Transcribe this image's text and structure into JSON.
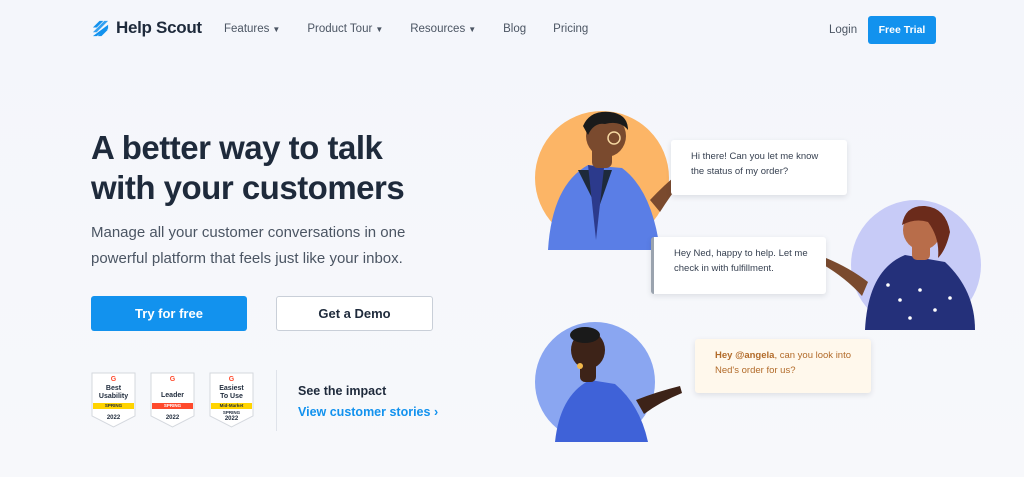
{
  "nav": {
    "brand": "Help Scout",
    "links": [
      {
        "label": "Features",
        "dropdown": true
      },
      {
        "label": "Product Tour",
        "dropdown": true
      },
      {
        "label": "Resources",
        "dropdown": true
      },
      {
        "label": "Blog",
        "dropdown": false
      },
      {
        "label": "Pricing",
        "dropdown": false
      }
    ],
    "login": "Login",
    "cta": "Free Trial"
  },
  "hero": {
    "title_line1": "A better way to talk",
    "title_line2": "with your customers",
    "subtitle": "Manage all your customer conversations in one powerful platform that feels just like your inbox.",
    "primary_button": "Try for free",
    "secondary_button": "Get a Demo"
  },
  "badges": [
    {
      "g": "G",
      "title_line1": "Best",
      "title_line2": "Usability",
      "ribbon": "SPRING",
      "year": "2022",
      "ribbon_color": "#ffd400"
    },
    {
      "g": "G",
      "title_line1": "Leader",
      "title_line2": "",
      "ribbon": "SPRING",
      "year": "2022",
      "ribbon_color": "#ff492c"
    },
    {
      "g": "G",
      "title_line1": "Easiest",
      "title_line2": "To Use",
      "ribbon": "Mid-Market",
      "year_line1": "SPRING",
      "year": "2022",
      "ribbon_color": "#ffd400"
    }
  ],
  "impact": {
    "label": "See the impact",
    "link": "View customer stories ›"
  },
  "chat": {
    "message1": "Hi there! Can you let me know the status of my order?",
    "message2": "Hey Ned, happy to help. Let me check in with fulfillment.",
    "message3_mention": "Hey @angela",
    "message3_rest": ", can you look into Ned's order for us?"
  },
  "colors": {
    "accent": "#1292ee",
    "heading": "#1e2a3b",
    "orange_circle": "#fcb566",
    "purple_circle": "#c7cbf7",
    "blue_circle": "#8aa6f1"
  }
}
